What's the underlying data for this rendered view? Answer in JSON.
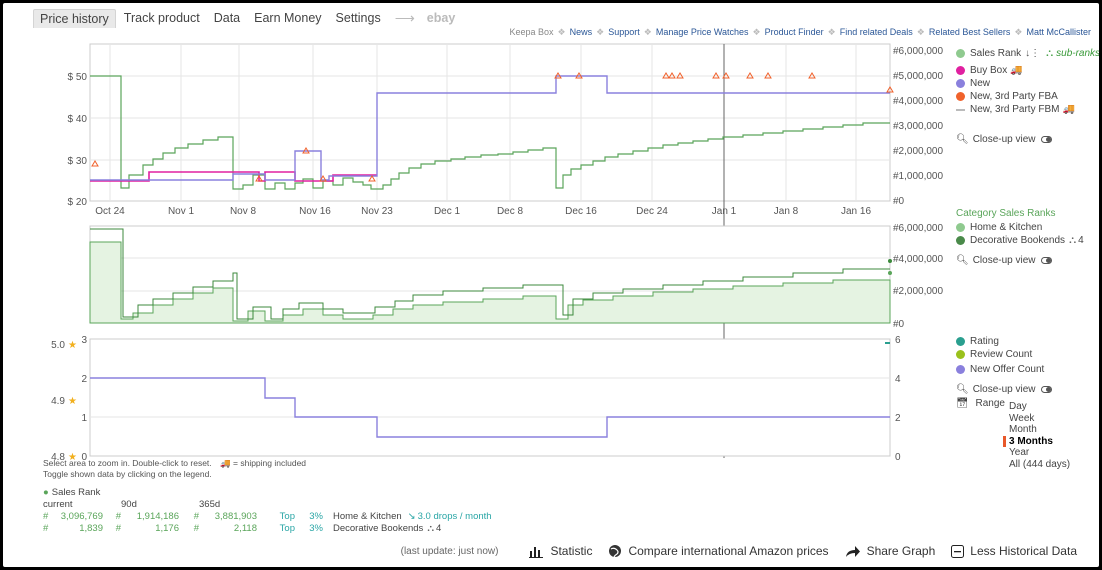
{
  "tabs": [
    {
      "label": "Price history",
      "active": true
    },
    {
      "label": "Track product"
    },
    {
      "label": "Data"
    },
    {
      "label": "Earn Money"
    },
    {
      "label": "Settings"
    },
    {
      "label": "ebay",
      "dim": true
    }
  ],
  "links": {
    "keepa_box": "Keepa Box",
    "news": "News",
    "support": "Support",
    "manage": "Manage Price Watches",
    "finder": "Product Finder",
    "deals": "Find related Deals",
    "sellers": "Related Best Sellers",
    "user": "Matt McCallister"
  },
  "chart1": {
    "y_left_ticks": [
      "$ 50",
      "$ 40",
      "$ 30",
      "$ 20"
    ],
    "y_right_ticks": [
      "#6,000,000",
      "#5,000,000",
      "#4,000,000",
      "#3,000,000",
      "#2,000,000",
      "#1,000,000",
      "#0"
    ],
    "x_ticks": [
      "Oct 24",
      "Nov 1",
      "Nov 8",
      "Nov 16",
      "Nov 23",
      "Dec 1",
      "Dec 8",
      "Dec 16",
      "Dec 24",
      "Jan 1",
      "Jan 8",
      "Jan 16"
    ]
  },
  "chart2": {
    "y_right_ticks": [
      "#6,000,000",
      "#4,000,000",
      "#2,000,000",
      "#0"
    ]
  },
  "chart3": {
    "y_left_ticks": [
      "5.0",
      "4.9",
      "4.8"
    ],
    "y_mid_ticks": [
      "3",
      "2",
      "1",
      "0"
    ],
    "y_right_ticks": [
      "6",
      "4",
      "2",
      "0"
    ]
  },
  "legend1": {
    "sales_rank": "Sales Rank",
    "sub_ranks": "sub-ranks",
    "buy_box": "Buy Box",
    "new": "New",
    "fba": "New, 3rd Party FBA",
    "fbm": "New, 3rd Party FBM",
    "closeup": "Close-up view"
  },
  "legend2": {
    "header": "Category Sales Ranks",
    "home": "Home & Kitchen",
    "bookends": "Decorative Bookends",
    "bookends_count": "4",
    "closeup": "Close-up view"
  },
  "legend3": {
    "rating": "Rating",
    "review": "Review Count",
    "offer": "New Offer Count",
    "closeup": "Close-up view"
  },
  "range": {
    "label": "Range",
    "options": [
      "Day",
      "Week",
      "Month",
      "3 Months",
      "Year",
      "All (444 days)"
    ],
    "selected": "3 Months"
  },
  "info": {
    "line1": "Select area to zoom in. Double-click to reset.",
    "line1b": "= shipping included",
    "line2": "Toggle shown data by clicking on the legend."
  },
  "stats": {
    "header": "Sales Rank",
    "cols": [
      "current",
      "90d",
      "365d"
    ],
    "rows": [
      {
        "c": "3,096,769",
        "d90": "1,914,186",
        "d365": "3,881,903",
        "top": "Top",
        "pct": "3%",
        "cat": "Home & Kitchen",
        "extra": "3.0 drops / month"
      },
      {
        "c": "1,839",
        "d90": "1,176",
        "d365": "2,118",
        "top": "Top",
        "pct": "3%",
        "cat": "Decorative Bookends",
        "extra": "4"
      }
    ]
  },
  "footer": {
    "update": "(last update: just now)",
    "statistic": "Statistic",
    "compare": "Compare international Amazon prices",
    "share": "Share Graph",
    "less": "Less Historical Data"
  },
  "colors": {
    "sales": "#5aa55a",
    "buybox": "#e020a0",
    "new": "#8a80dd",
    "fba": "#f0622c",
    "fbm": "#bbbbbb",
    "rating": "#2a9f8f",
    "review": "#9ac11c"
  }
}
